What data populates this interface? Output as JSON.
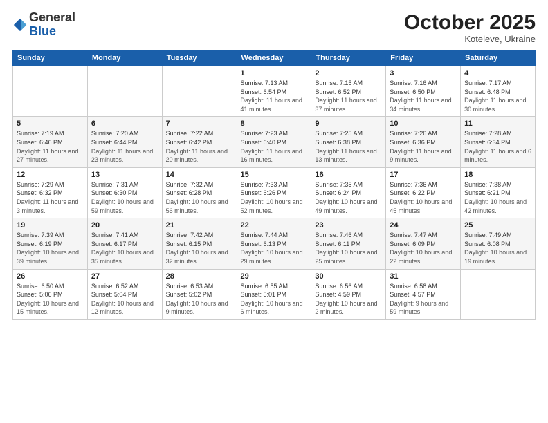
{
  "header": {
    "logo_general": "General",
    "logo_blue": "Blue",
    "month": "October 2025",
    "location": "Koteleve, Ukraine"
  },
  "weekdays": [
    "Sunday",
    "Monday",
    "Tuesday",
    "Wednesday",
    "Thursday",
    "Friday",
    "Saturday"
  ],
  "weeks": [
    [
      {
        "day": "",
        "info": ""
      },
      {
        "day": "",
        "info": ""
      },
      {
        "day": "",
        "info": ""
      },
      {
        "day": "1",
        "sunrise": "7:13 AM",
        "sunset": "6:54 PM",
        "daylight": "11 hours and 41 minutes."
      },
      {
        "day": "2",
        "sunrise": "7:15 AM",
        "sunset": "6:52 PM",
        "daylight": "11 hours and 37 minutes."
      },
      {
        "day": "3",
        "sunrise": "7:16 AM",
        "sunset": "6:50 PM",
        "daylight": "11 hours and 34 minutes."
      },
      {
        "day": "4",
        "sunrise": "7:17 AM",
        "sunset": "6:48 PM",
        "daylight": "11 hours and 30 minutes."
      }
    ],
    [
      {
        "day": "5",
        "sunrise": "7:19 AM",
        "sunset": "6:46 PM",
        "daylight": "11 hours and 27 minutes."
      },
      {
        "day": "6",
        "sunrise": "7:20 AM",
        "sunset": "6:44 PM",
        "daylight": "11 hours and 23 minutes."
      },
      {
        "day": "7",
        "sunrise": "7:22 AM",
        "sunset": "6:42 PM",
        "daylight": "11 hours and 20 minutes."
      },
      {
        "day": "8",
        "sunrise": "7:23 AM",
        "sunset": "6:40 PM",
        "daylight": "11 hours and 16 minutes."
      },
      {
        "day": "9",
        "sunrise": "7:25 AM",
        "sunset": "6:38 PM",
        "daylight": "11 hours and 13 minutes."
      },
      {
        "day": "10",
        "sunrise": "7:26 AM",
        "sunset": "6:36 PM",
        "daylight": "11 hours and 9 minutes."
      },
      {
        "day": "11",
        "sunrise": "7:28 AM",
        "sunset": "6:34 PM",
        "daylight": "11 hours and 6 minutes."
      }
    ],
    [
      {
        "day": "12",
        "sunrise": "7:29 AM",
        "sunset": "6:32 PM",
        "daylight": "11 hours and 3 minutes."
      },
      {
        "day": "13",
        "sunrise": "7:31 AM",
        "sunset": "6:30 PM",
        "daylight": "10 hours and 59 minutes."
      },
      {
        "day": "14",
        "sunrise": "7:32 AM",
        "sunset": "6:28 PM",
        "daylight": "10 hours and 56 minutes."
      },
      {
        "day": "15",
        "sunrise": "7:33 AM",
        "sunset": "6:26 PM",
        "daylight": "10 hours and 52 minutes."
      },
      {
        "day": "16",
        "sunrise": "7:35 AM",
        "sunset": "6:24 PM",
        "daylight": "10 hours and 49 minutes."
      },
      {
        "day": "17",
        "sunrise": "7:36 AM",
        "sunset": "6:22 PM",
        "daylight": "10 hours and 45 minutes."
      },
      {
        "day": "18",
        "sunrise": "7:38 AM",
        "sunset": "6:21 PM",
        "daylight": "10 hours and 42 minutes."
      }
    ],
    [
      {
        "day": "19",
        "sunrise": "7:39 AM",
        "sunset": "6:19 PM",
        "daylight": "10 hours and 39 minutes."
      },
      {
        "day": "20",
        "sunrise": "7:41 AM",
        "sunset": "6:17 PM",
        "daylight": "10 hours and 35 minutes."
      },
      {
        "day": "21",
        "sunrise": "7:42 AM",
        "sunset": "6:15 PM",
        "daylight": "10 hours and 32 minutes."
      },
      {
        "day": "22",
        "sunrise": "7:44 AM",
        "sunset": "6:13 PM",
        "daylight": "10 hours and 29 minutes."
      },
      {
        "day": "23",
        "sunrise": "7:46 AM",
        "sunset": "6:11 PM",
        "daylight": "10 hours and 25 minutes."
      },
      {
        "day": "24",
        "sunrise": "7:47 AM",
        "sunset": "6:09 PM",
        "daylight": "10 hours and 22 minutes."
      },
      {
        "day": "25",
        "sunrise": "7:49 AM",
        "sunset": "6:08 PM",
        "daylight": "10 hours and 19 minutes."
      }
    ],
    [
      {
        "day": "26",
        "sunrise": "6:50 AM",
        "sunset": "5:06 PM",
        "daylight": "10 hours and 15 minutes."
      },
      {
        "day": "27",
        "sunrise": "6:52 AM",
        "sunset": "5:04 PM",
        "daylight": "10 hours and 12 minutes."
      },
      {
        "day": "28",
        "sunrise": "6:53 AM",
        "sunset": "5:02 PM",
        "daylight": "10 hours and 9 minutes."
      },
      {
        "day": "29",
        "sunrise": "6:55 AM",
        "sunset": "5:01 PM",
        "daylight": "10 hours and 6 minutes."
      },
      {
        "day": "30",
        "sunrise": "6:56 AM",
        "sunset": "4:59 PM",
        "daylight": "10 hours and 2 minutes."
      },
      {
        "day": "31",
        "sunrise": "6:58 AM",
        "sunset": "4:57 PM",
        "daylight": "9 hours and 59 minutes."
      },
      {
        "day": "",
        "info": ""
      }
    ]
  ]
}
